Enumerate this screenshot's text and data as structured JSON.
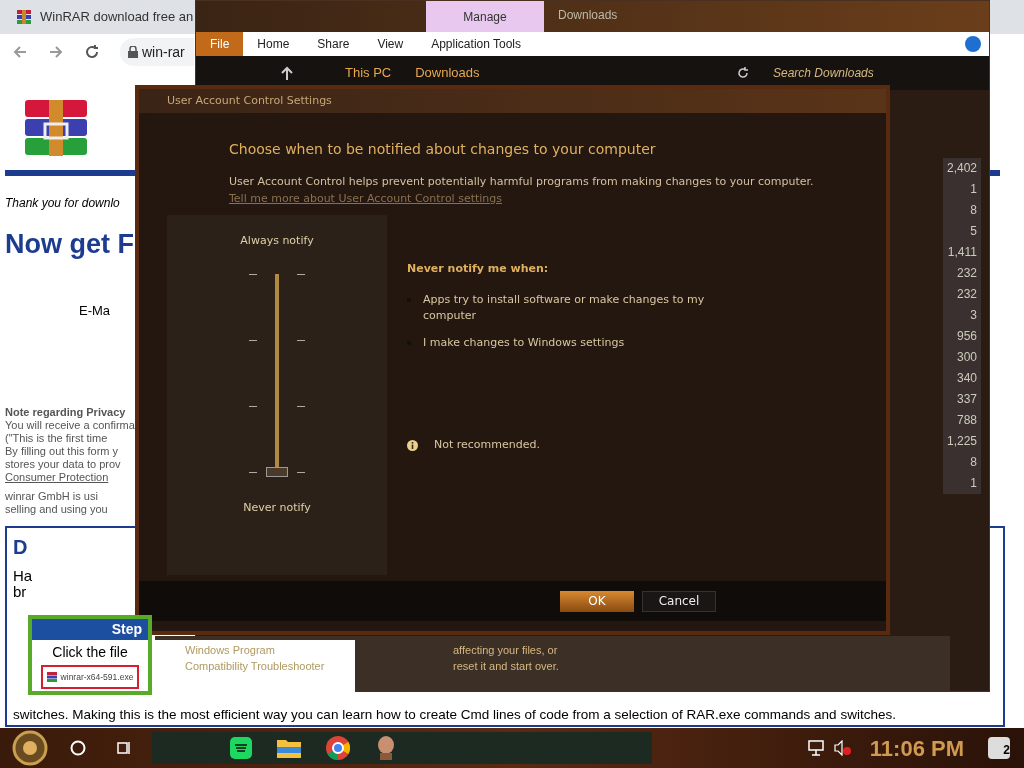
{
  "browser": {
    "tab_title": "WinRAR download free an",
    "address": "win-rar",
    "page": {
      "intro": "Thank you for downlo",
      "heading": "Now get F",
      "email_label": "E-Ma",
      "privacy": [
        "Note regarding Privacy",
        "You will receive a confirma",
        "(\"This is the first time",
        "By filling out this form y",
        "stores your data to prov"
      ],
      "privacy_link": "Consumer Protection",
      "company": [
        "winrar GmbH is usi",
        "selling and using you"
      ],
      "box_heading": "D",
      "step": {
        "title": "Step",
        "instruction": "Click the file",
        "file": "winrar-x64-591.exe"
      },
      "side_text": [
        "Ha",
        "br"
      ],
      "footer": "switches. Making this is the most efficient way you can learn how to create Cmd lines of code from a selection of RAR.exe commands and switches."
    }
  },
  "explorer": {
    "title": "Downloads",
    "context_tab": {
      "label": "Manage",
      "selected": true
    },
    "ribbon_tabs": [
      {
        "label": "File",
        "selected": true
      },
      {
        "label": "Home",
        "selected": false
      },
      {
        "label": "Share",
        "selected": false
      },
      {
        "label": "View",
        "selected": false
      },
      {
        "label": "Application Tools",
        "selected": false
      }
    ],
    "breadcrumb": [
      "This PC",
      "Downloads"
    ],
    "search": {
      "placeholder": "Search Downloads"
    },
    "sizes": [
      "2,402",
      "1",
      "8",
      "5",
      "1,411",
      "232",
      "232",
      "3",
      "956",
      "300",
      "340",
      "337",
      "788",
      "1,225",
      "8",
      "1"
    ]
  },
  "troubleshooter": {
    "left": [
      "Windows Program",
      "Compatibility Troubleshooter"
    ],
    "right": [
      "affecting your files, or",
      "reset it and start over."
    ]
  },
  "uac": {
    "title": "User Account Control Settings",
    "heading": "Choose when to be notified about changes to your computer",
    "description": "User Account Control helps prevent potentially harmful programs from making changes to your computer.",
    "link": "Tell me more about User Account Control settings",
    "slider": {
      "top_label": "Always notify",
      "bottom_label": "Never notify",
      "level": 0
    },
    "panel": {
      "heading": "Never notify me when:",
      "bullets": [
        "Apps try to install software or make changes to my computer",
        "I make changes to Windows settings"
      ],
      "note": "Not recommended."
    },
    "buttons": [
      {
        "label": "OK",
        "default": true
      },
      {
        "label": "Cancel",
        "default": false
      }
    ]
  },
  "taskbar": {
    "clock": "11:06 PM",
    "notifications": "2"
  }
}
